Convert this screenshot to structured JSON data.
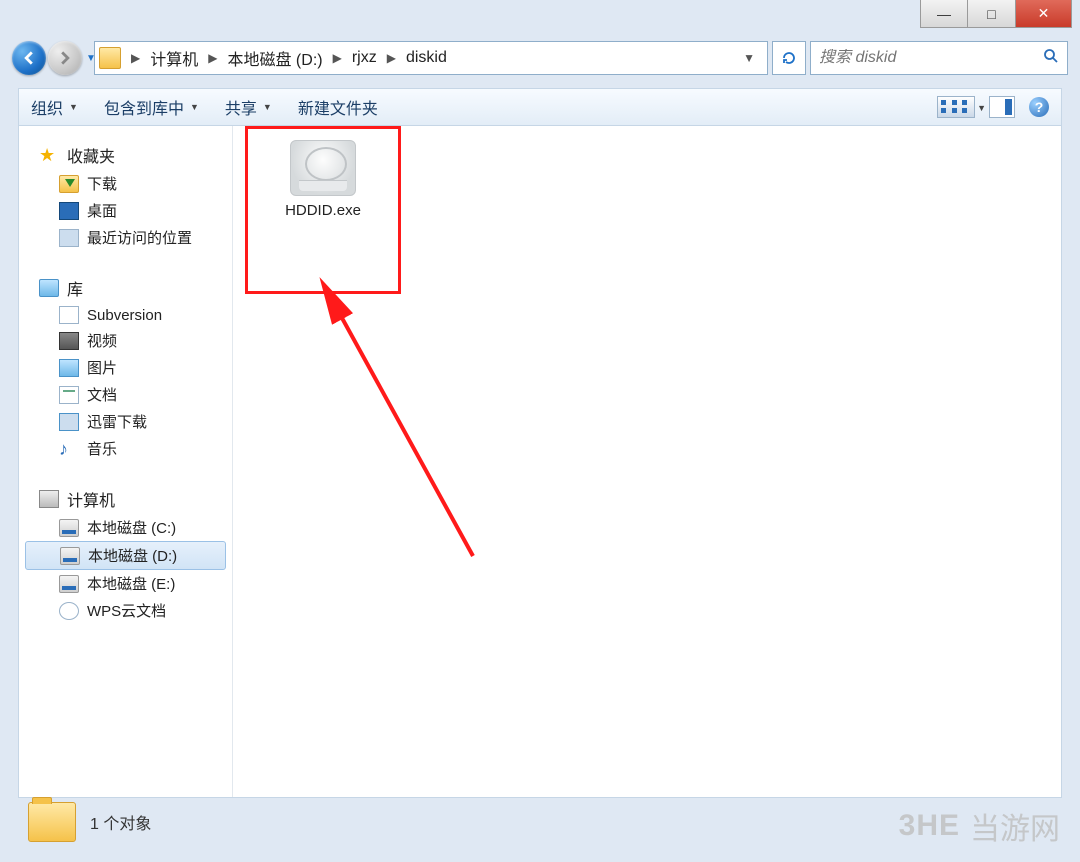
{
  "breadcrumb": {
    "root": "计算机",
    "drive": "本地磁盘 (D:)",
    "p1": "rjxz",
    "p2": "diskid"
  },
  "search": {
    "placeholder": "搜索 diskid"
  },
  "toolbar": {
    "organize": "组织",
    "include": "包含到库中",
    "share": "共享",
    "newfolder": "新建文件夹"
  },
  "sidebar": {
    "fav_label": "收藏夹",
    "fav": {
      "downloads": "下载",
      "desktop": "桌面",
      "recent": "最近访问的位置"
    },
    "lib_label": "库",
    "lib": {
      "svn": "Subversion",
      "video": "视频",
      "pic": "图片",
      "doc": "文档",
      "xl": "迅雷下载",
      "music": "音乐"
    },
    "pc_label": "计算机",
    "pc": {
      "c": "本地磁盘 (C:)",
      "d": "本地磁盘 (D:)",
      "e": "本地磁盘 (E:)",
      "wps": "WPS云文档"
    }
  },
  "file": {
    "name": "HDDID.exe"
  },
  "status": {
    "count": "1 个对象"
  },
  "watermark": {
    "logo": "3HE",
    "text": "当游网"
  }
}
